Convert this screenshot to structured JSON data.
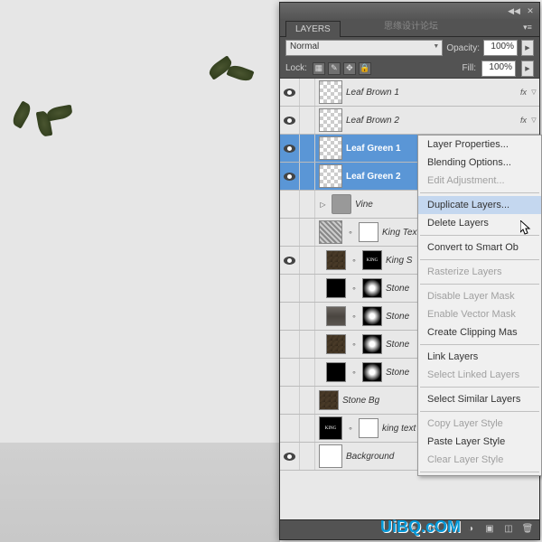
{
  "panel": {
    "title": "LAYERS"
  },
  "blend": {
    "mode": "Normal",
    "opacity_label": "Opacity:",
    "opacity": "100%"
  },
  "lock": {
    "label": "Lock:",
    "fill_label": "Fill:",
    "fill": "100%"
  },
  "layers": [
    {
      "name": "Leaf Brown 1",
      "vis": true,
      "thumb": "checker",
      "fx": true,
      "sel": false
    },
    {
      "name": "Leaf Brown 2",
      "vis": true,
      "thumb": "checker",
      "fx": true,
      "sel": false
    },
    {
      "name": "Leaf Green 1",
      "vis": true,
      "thumb": "checker",
      "fx": false,
      "sel": true
    },
    {
      "name": "Leaf Green 2",
      "vis": true,
      "thumb": "checker",
      "fx": false,
      "sel": true
    },
    {
      "name": "Vine",
      "vis": false,
      "thumb": "folder",
      "fx": false,
      "sel": false,
      "group": true
    },
    {
      "name": "King Text Sharp",
      "vis": false,
      "thumb": "sharp",
      "fx": false,
      "sel": false,
      "mask": "white"
    },
    {
      "name": "King S",
      "vis": true,
      "thumb": "texture",
      "fx": false,
      "sel": false,
      "mask": "king",
      "smart": true,
      "indent": true
    },
    {
      "name": "Stone",
      "vis": false,
      "thumb": "black",
      "fx": false,
      "sel": false,
      "mask": "gradient",
      "smart": true,
      "indent": true
    },
    {
      "name": "Stone",
      "vis": false,
      "thumb": "stone",
      "fx": false,
      "sel": false,
      "mask": "gradient",
      "smart": true,
      "indent": true
    },
    {
      "name": "Stone",
      "vis": false,
      "thumb": "texture",
      "fx": false,
      "sel": false,
      "mask": "gradient",
      "smart": true,
      "indent": true
    },
    {
      "name": "Stone",
      "vis": false,
      "thumb": "black",
      "fx": false,
      "sel": false,
      "mask": "gradient",
      "smart": true,
      "indent": true
    },
    {
      "name": "Stone Bg",
      "vis": false,
      "thumb": "texture",
      "fx": false,
      "sel": false,
      "smart": true
    },
    {
      "name": "king text",
      "vis": false,
      "thumb": "king",
      "fx": false,
      "sel": false,
      "mask": "white"
    },
    {
      "name": "Background",
      "vis": true,
      "thumb": "white",
      "fx": false,
      "sel": false,
      "locked": true
    }
  ],
  "context": [
    {
      "t": "Layer Properties...",
      "en": true
    },
    {
      "t": "Blending Options...",
      "en": true
    },
    {
      "t": "Edit Adjustment...",
      "en": false
    },
    {
      "sep": true
    },
    {
      "t": "Duplicate Layers...",
      "en": true,
      "hover": true
    },
    {
      "t": "Delete Layers",
      "en": true
    },
    {
      "sep": true
    },
    {
      "t": "Convert to Smart Ob",
      "en": true
    },
    {
      "sep": true
    },
    {
      "t": "Rasterize Layers",
      "en": false
    },
    {
      "sep": true
    },
    {
      "t": "Disable Layer Mask",
      "en": false
    },
    {
      "t": "Enable Vector Mask",
      "en": false
    },
    {
      "t": "Create Clipping Mas",
      "en": true
    },
    {
      "sep": true
    },
    {
      "t": "Link Layers",
      "en": true
    },
    {
      "t": "Select Linked Layers",
      "en": false
    },
    {
      "sep": true
    },
    {
      "t": "Select Similar Layers",
      "en": true
    },
    {
      "sep": true
    },
    {
      "t": "Copy Layer Style",
      "en": false
    },
    {
      "t": "Paste Layer Style",
      "en": true
    },
    {
      "t": "Clear Layer Style",
      "en": false
    },
    {
      "sep": true
    }
  ],
  "watermark": {
    "main": "UiBQ.cOM",
    "top": "思缘设计论坛"
  },
  "king_text": "KING"
}
